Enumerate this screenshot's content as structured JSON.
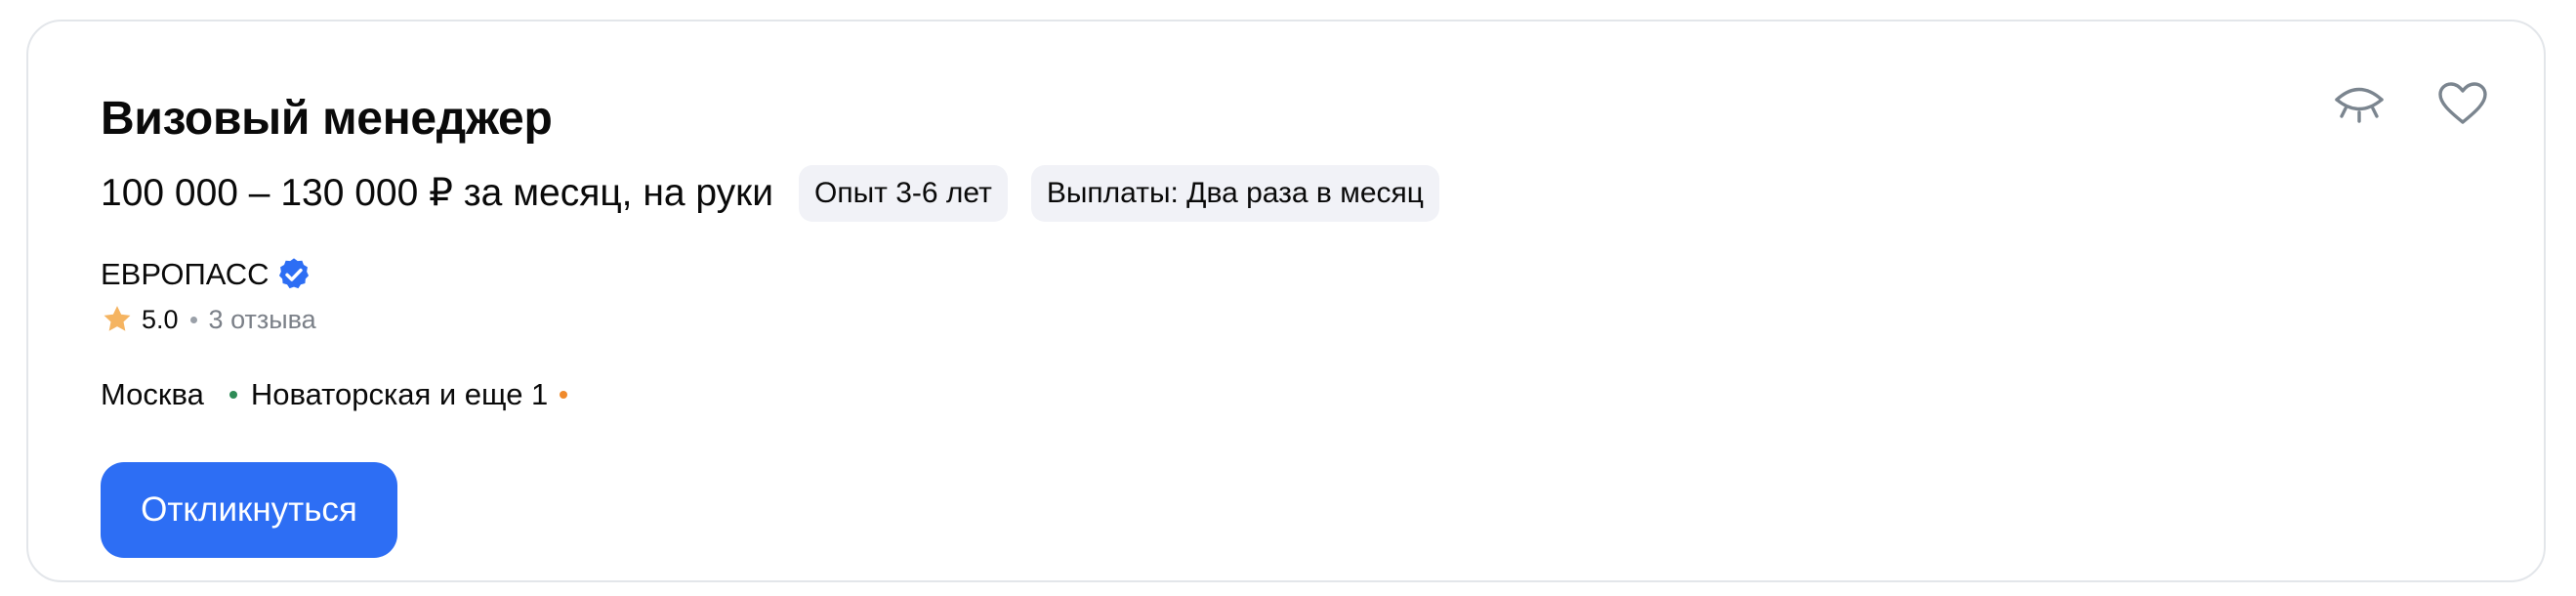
{
  "vacancy": {
    "title": "Визовый менеджер",
    "salary": "100 000 – 130 000 ₽ за месяц, на руки",
    "chips": [
      "Опыт 3-6 лет",
      "Выплаты: Два раза в месяц"
    ]
  },
  "company": {
    "name": "ЕВРОПАСС",
    "verified_icon": "verified-badge-icon",
    "rating": "5.0",
    "reviews": "3 отзыва"
  },
  "location": {
    "city": "Москва",
    "metro": "Новаторская и еще 1",
    "metro_colors": [
      "#2e8b57",
      "#f08a2c"
    ]
  },
  "actions": {
    "apply_label": "Откликнуться",
    "hide_icon": "eye-closed-icon",
    "favorite_icon": "heart-icon"
  },
  "colors": {
    "accent": "#2d6ef4",
    "star": "#f5b461",
    "chip_bg": "#f1f2f7",
    "verified": "#2d6ef4"
  }
}
